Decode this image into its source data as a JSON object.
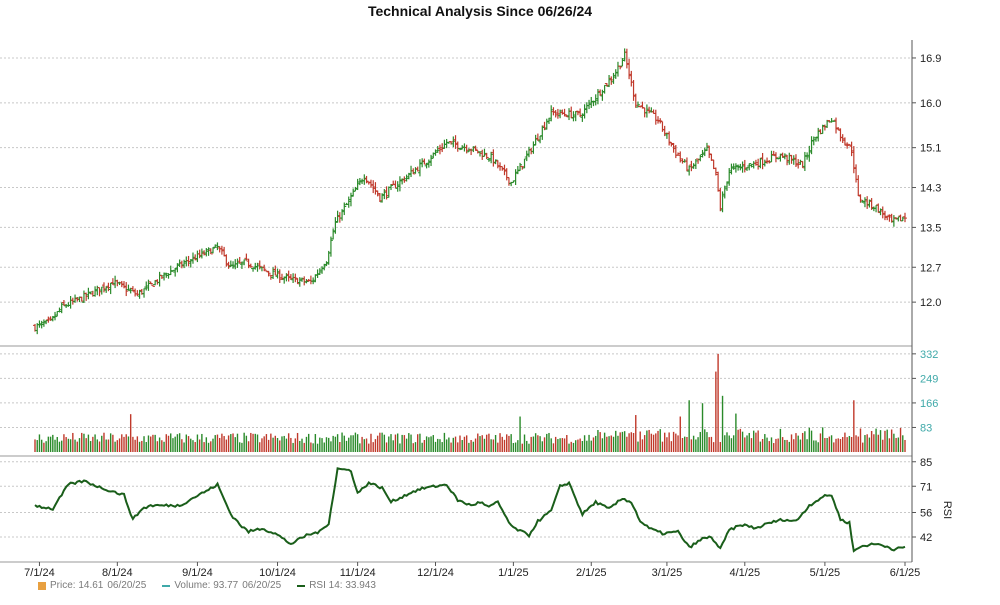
{
  "chart_data": {
    "type": "candlestick",
    "title": "Technical Analysis Since 06/26/24",
    "x_tick_labels": [
      "7/1/24",
      "8/1/24",
      "9/1/24",
      "10/1/24",
      "11/1/24",
      "12/1/24",
      "1/1/25",
      "2/1/25",
      "3/1/25",
      "4/1/25",
      "5/1/25",
      "6/1/25"
    ],
    "price_panel": {
      "y_ticks": [
        12.0,
        12.7,
        13.5,
        14.3,
        15.1,
        16.0,
        16.9
      ],
      "y_tick_labels": [
        "12.0",
        "12.7",
        "13.5",
        "14.3",
        "15.1",
        "16.0",
        "16.9"
      ],
      "ylim": [
        11.2,
        17.1
      ]
    },
    "volume_panel": {
      "y_ticks": [
        83,
        166,
        249,
        332
      ],
      "y_tick_labels": [
        "83",
        "166",
        "249",
        "332"
      ],
      "ylim": [
        0,
        345
      ]
    },
    "rsi_panel": {
      "label": "RSI",
      "y_ticks": [
        42,
        56,
        71,
        85
      ],
      "y_tick_labels": [
        "42",
        "56",
        "71",
        "85"
      ],
      "ylim": [
        30,
        86
      ]
    },
    "price_keypoints": [
      [
        0,
        11.5
      ],
      [
        7,
        11.6
      ],
      [
        12,
        11.9
      ],
      [
        22,
        12.1
      ],
      [
        35,
        12.4
      ],
      [
        46,
        12.15
      ],
      [
        60,
        12.6
      ],
      [
        70,
        12.85
      ],
      [
        82,
        13.1
      ],
      [
        88,
        12.7
      ],
      [
        95,
        12.8
      ],
      [
        105,
        12.6
      ],
      [
        115,
        12.45
      ],
      [
        124,
        12.4
      ],
      [
        131,
        12.85
      ],
      [
        135,
        13.6
      ],
      [
        140,
        13.95
      ],
      [
        148,
        14.55
      ],
      [
        155,
        14.1
      ],
      [
        165,
        14.45
      ],
      [
        175,
        14.8
      ],
      [
        185,
        15.2
      ],
      [
        195,
        15.1
      ],
      [
        205,
        14.9
      ],
      [
        214,
        14.4
      ],
      [
        222,
        15.0
      ],
      [
        232,
        15.8
      ],
      [
        245,
        15.75
      ],
      [
        260,
        16.55
      ],
      [
        265,
        16.95
      ],
      [
        270,
        16.0
      ],
      [
        280,
        15.65
      ],
      [
        288,
        15.0
      ],
      [
        294,
        14.65
      ],
      [
        302,
        15.05
      ],
      [
        306,
        14.55
      ],
      [
        308,
        13.9
      ],
      [
        312,
        14.65
      ],
      [
        325,
        14.8
      ],
      [
        335,
        14.95
      ],
      [
        345,
        14.75
      ],
      [
        350,
        15.3
      ],
      [
        358,
        15.7
      ],
      [
        362,
        15.35
      ],
      [
        367,
        15.05
      ],
      [
        370,
        14.1
      ],
      [
        378,
        13.9
      ],
      [
        385,
        13.6
      ],
      [
        391,
        13.7
      ]
    ],
    "rsi_keypoints": [
      [
        0,
        60
      ],
      [
        8,
        58
      ],
      [
        15,
        72
      ],
      [
        22,
        74
      ],
      [
        30,
        70
      ],
      [
        40,
        66
      ],
      [
        44,
        52
      ],
      [
        48,
        58
      ],
      [
        52,
        60
      ],
      [
        58,
        60
      ],
      [
        65,
        60
      ],
      [
        72,
        65
      ],
      [
        78,
        69
      ],
      [
        82,
        72
      ],
      [
        88,
        55
      ],
      [
        93,
        48
      ],
      [
        96,
        45
      ],
      [
        102,
        47
      ],
      [
        108,
        44
      ],
      [
        115,
        38
      ],
      [
        122,
        43
      ],
      [
        128,
        45
      ],
      [
        132,
        50
      ],
      [
        136,
        81
      ],
      [
        142,
        80
      ],
      [
        145,
        67
      ],
      [
        150,
        73
      ],
      [
        156,
        70
      ],
      [
        160,
        62
      ],
      [
        165,
        65
      ],
      [
        170,
        68
      ],
      [
        175,
        70
      ],
      [
        180,
        71
      ],
      [
        185,
        72
      ],
      [
        190,
        63
      ],
      [
        196,
        60
      ],
      [
        200,
        62
      ],
      [
        204,
        59
      ],
      [
        208,
        62
      ],
      [
        214,
        48
      ],
      [
        222,
        43
      ],
      [
        226,
        51
      ],
      [
        232,
        57
      ],
      [
        236,
        71
      ],
      [
        240,
        73
      ],
      [
        246,
        55
      ],
      [
        252,
        62
      ],
      [
        258,
        58
      ],
      [
        264,
        64
      ],
      [
        268,
        62
      ],
      [
        272,
        51
      ],
      [
        276,
        47
      ],
      [
        282,
        44
      ],
      [
        289,
        45
      ],
      [
        294,
        36
      ],
      [
        300,
        41
      ],
      [
        304,
        42
      ],
      [
        308,
        35
      ],
      [
        312,
        46
      ],
      [
        318,
        49
      ],
      [
        324,
        47
      ],
      [
        330,
        50
      ],
      [
        336,
        52
      ],
      [
        342,
        51
      ],
      [
        348,
        60
      ],
      [
        354,
        65
      ],
      [
        358,
        66
      ],
      [
        362,
        52
      ],
      [
        366,
        50
      ],
      [
        368,
        34
      ],
      [
        372,
        37
      ],
      [
        378,
        38
      ],
      [
        382,
        37
      ],
      [
        386,
        35
      ],
      [
        391,
        36
      ]
    ],
    "volume_spikes": [
      [
        43,
        128
      ],
      [
        218,
        120
      ],
      [
        270,
        125
      ],
      [
        290,
        120
      ],
      [
        294,
        175
      ],
      [
        300,
        165
      ],
      [
        306,
        272
      ],
      [
        307,
        332
      ],
      [
        309,
        190
      ],
      [
        315,
        130
      ],
      [
        368,
        175
      ]
    ],
    "legend": [
      {
        "label": "Price: 14.61",
        "date": "06/20/25",
        "color": "#e8a040"
      },
      {
        "label": "Volume: 93.77",
        "date": "06/20/25",
        "color": "#3fa9a9"
      },
      {
        "label": "RSI 14: 33.943",
        "date": "",
        "color": "#1a5e1a"
      }
    ],
    "colors": {
      "up": "#2a8a2a",
      "down": "#c0392b",
      "rsi_line": "#1a5e1a",
      "grid": "#c8c8c8",
      "volume_axis": "#3fa9a9"
    },
    "grid": true
  }
}
